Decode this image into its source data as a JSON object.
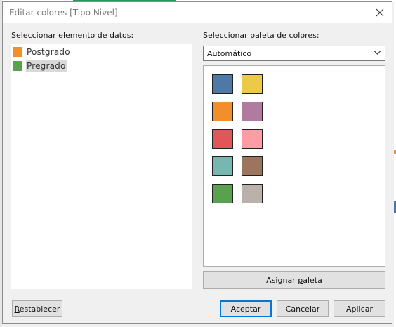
{
  "dialog": {
    "title": "Editar colores [Tipo Nivel]"
  },
  "data_items": {
    "label": "Seleccionar elemento de datos:",
    "items": [
      {
        "label": "Postgrado",
        "color": "#f28e2b"
      },
      {
        "label": "Pregrado",
        "color": "#59a14f"
      }
    ]
  },
  "palette": {
    "label": "Seleccionar paleta de colores:",
    "selected": "Automático",
    "colors": [
      "#4e79a7",
      "#edc948",
      "#f28e2b",
      "#b07aa1",
      "#e15759",
      "#ff9da7",
      "#76b7b2",
      "#9c755f",
      "#59a14f",
      "#bab0ac"
    ],
    "assign_button": {
      "pre": "Asignar ",
      "underline": "p",
      "post": "aleta"
    }
  },
  "buttons": {
    "reset": {
      "underline": "R",
      "post": "establecer"
    },
    "accept": "Aceptar",
    "cancel": "Cancelar",
    "apply": "Aplicar"
  }
}
